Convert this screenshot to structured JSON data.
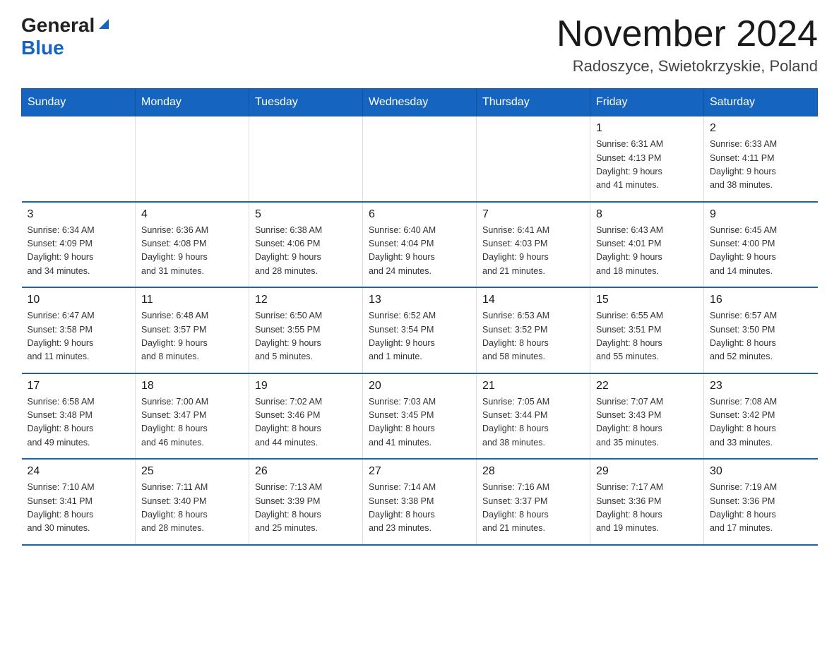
{
  "header": {
    "logo_general": "General",
    "logo_blue": "Blue",
    "month_year": "November 2024",
    "location": "Radoszyce, Swietokrzyskie, Poland"
  },
  "days_of_week": [
    "Sunday",
    "Monday",
    "Tuesday",
    "Wednesday",
    "Thursday",
    "Friday",
    "Saturday"
  ],
  "weeks": [
    [
      {
        "day": "",
        "info": ""
      },
      {
        "day": "",
        "info": ""
      },
      {
        "day": "",
        "info": ""
      },
      {
        "day": "",
        "info": ""
      },
      {
        "day": "",
        "info": ""
      },
      {
        "day": "1",
        "info": "Sunrise: 6:31 AM\nSunset: 4:13 PM\nDaylight: 9 hours\nand 41 minutes."
      },
      {
        "day": "2",
        "info": "Sunrise: 6:33 AM\nSunset: 4:11 PM\nDaylight: 9 hours\nand 38 minutes."
      }
    ],
    [
      {
        "day": "3",
        "info": "Sunrise: 6:34 AM\nSunset: 4:09 PM\nDaylight: 9 hours\nand 34 minutes."
      },
      {
        "day": "4",
        "info": "Sunrise: 6:36 AM\nSunset: 4:08 PM\nDaylight: 9 hours\nand 31 minutes."
      },
      {
        "day": "5",
        "info": "Sunrise: 6:38 AM\nSunset: 4:06 PM\nDaylight: 9 hours\nand 28 minutes."
      },
      {
        "day": "6",
        "info": "Sunrise: 6:40 AM\nSunset: 4:04 PM\nDaylight: 9 hours\nand 24 minutes."
      },
      {
        "day": "7",
        "info": "Sunrise: 6:41 AM\nSunset: 4:03 PM\nDaylight: 9 hours\nand 21 minutes."
      },
      {
        "day": "8",
        "info": "Sunrise: 6:43 AM\nSunset: 4:01 PM\nDaylight: 9 hours\nand 18 minutes."
      },
      {
        "day": "9",
        "info": "Sunrise: 6:45 AM\nSunset: 4:00 PM\nDaylight: 9 hours\nand 14 minutes."
      }
    ],
    [
      {
        "day": "10",
        "info": "Sunrise: 6:47 AM\nSunset: 3:58 PM\nDaylight: 9 hours\nand 11 minutes."
      },
      {
        "day": "11",
        "info": "Sunrise: 6:48 AM\nSunset: 3:57 PM\nDaylight: 9 hours\nand 8 minutes."
      },
      {
        "day": "12",
        "info": "Sunrise: 6:50 AM\nSunset: 3:55 PM\nDaylight: 9 hours\nand 5 minutes."
      },
      {
        "day": "13",
        "info": "Sunrise: 6:52 AM\nSunset: 3:54 PM\nDaylight: 9 hours\nand 1 minute."
      },
      {
        "day": "14",
        "info": "Sunrise: 6:53 AM\nSunset: 3:52 PM\nDaylight: 8 hours\nand 58 minutes."
      },
      {
        "day": "15",
        "info": "Sunrise: 6:55 AM\nSunset: 3:51 PM\nDaylight: 8 hours\nand 55 minutes."
      },
      {
        "day": "16",
        "info": "Sunrise: 6:57 AM\nSunset: 3:50 PM\nDaylight: 8 hours\nand 52 minutes."
      }
    ],
    [
      {
        "day": "17",
        "info": "Sunrise: 6:58 AM\nSunset: 3:48 PM\nDaylight: 8 hours\nand 49 minutes."
      },
      {
        "day": "18",
        "info": "Sunrise: 7:00 AM\nSunset: 3:47 PM\nDaylight: 8 hours\nand 46 minutes."
      },
      {
        "day": "19",
        "info": "Sunrise: 7:02 AM\nSunset: 3:46 PM\nDaylight: 8 hours\nand 44 minutes."
      },
      {
        "day": "20",
        "info": "Sunrise: 7:03 AM\nSunset: 3:45 PM\nDaylight: 8 hours\nand 41 minutes."
      },
      {
        "day": "21",
        "info": "Sunrise: 7:05 AM\nSunset: 3:44 PM\nDaylight: 8 hours\nand 38 minutes."
      },
      {
        "day": "22",
        "info": "Sunrise: 7:07 AM\nSunset: 3:43 PM\nDaylight: 8 hours\nand 35 minutes."
      },
      {
        "day": "23",
        "info": "Sunrise: 7:08 AM\nSunset: 3:42 PM\nDaylight: 8 hours\nand 33 minutes."
      }
    ],
    [
      {
        "day": "24",
        "info": "Sunrise: 7:10 AM\nSunset: 3:41 PM\nDaylight: 8 hours\nand 30 minutes."
      },
      {
        "day": "25",
        "info": "Sunrise: 7:11 AM\nSunset: 3:40 PM\nDaylight: 8 hours\nand 28 minutes."
      },
      {
        "day": "26",
        "info": "Sunrise: 7:13 AM\nSunset: 3:39 PM\nDaylight: 8 hours\nand 25 minutes."
      },
      {
        "day": "27",
        "info": "Sunrise: 7:14 AM\nSunset: 3:38 PM\nDaylight: 8 hours\nand 23 minutes."
      },
      {
        "day": "28",
        "info": "Sunrise: 7:16 AM\nSunset: 3:37 PM\nDaylight: 8 hours\nand 21 minutes."
      },
      {
        "day": "29",
        "info": "Sunrise: 7:17 AM\nSunset: 3:36 PM\nDaylight: 8 hours\nand 19 minutes."
      },
      {
        "day": "30",
        "info": "Sunrise: 7:19 AM\nSunset: 3:36 PM\nDaylight: 8 hours\nand 17 minutes."
      }
    ]
  ]
}
